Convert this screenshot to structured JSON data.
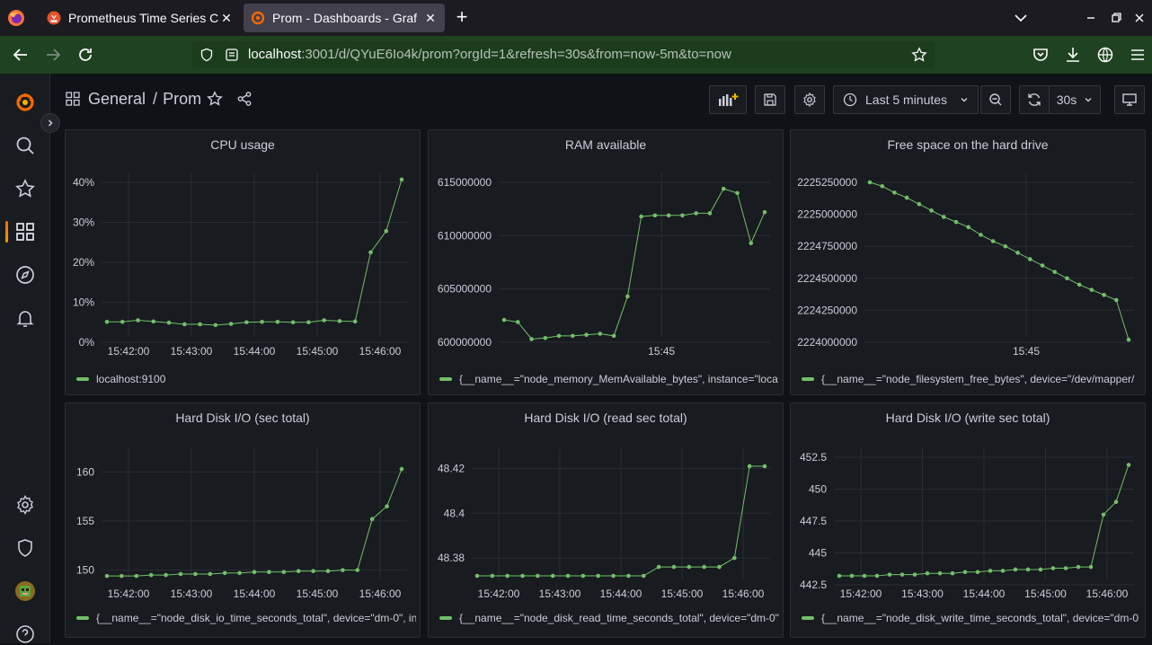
{
  "browser": {
    "tabs": [
      {
        "title": "Prometheus Time Series C",
        "active": false
      },
      {
        "title": "Prom - Dashboards - Graf",
        "active": true
      }
    ],
    "url_host": "localhost",
    "url_path": ":3001/d/QYuE6Io4k/prom?orgId=1&refresh=30s&from=now-5m&to=now"
  },
  "breadcrumb": {
    "folder": "General",
    "separator": "/",
    "dashboard": "Prom"
  },
  "toolbar": {
    "time_range": "Last 5 minutes",
    "refresh_interval": "30s"
  },
  "colors": {
    "series": "#73bf69",
    "background": "#111217",
    "panel": "#181b1f"
  },
  "panels": [
    {
      "title": "CPU usage",
      "legend": "localhost:9100",
      "chart_data": {
        "type": "line",
        "x": [
          "15:41:35",
          "15:41:50",
          "15:42:05",
          "15:42:20",
          "15:42:35",
          "15:42:50",
          "15:43:05",
          "15:43:20",
          "15:43:35",
          "15:43:50",
          "15:44:05",
          "15:44:20",
          "15:44:35",
          "15:44:50",
          "15:45:05",
          "15:45:20",
          "15:45:35",
          "15:45:50",
          "15:46:05",
          "15:46:20",
          "15:46:35"
        ],
        "values": [
          5.1,
          5.1,
          5.5,
          5.2,
          4.9,
          4.5,
          4.5,
          4.3,
          4.6,
          5.0,
          5.1,
          5.1,
          5.0,
          5.0,
          5.5,
          5.3,
          5.2,
          22.5,
          27.8,
          40.7
        ],
        "yticks": [
          "0%",
          "10%",
          "20%",
          "30%",
          "40%"
        ],
        "xticks": [
          "15:42:00",
          "15:43:00",
          "15:44:00",
          "15:45:00",
          "15:46:00"
        ],
        "ylim": [
          0,
          40
        ]
      }
    },
    {
      "title": "RAM available",
      "legend": "{__name__=\"node_memory_MemAvailable_bytes\", instance=\"loca",
      "chart_data": {
        "type": "line",
        "values": [
          602100000,
          601900000,
          600300000,
          600400000,
          600600000,
          600600000,
          600700000,
          600800000,
          600600000,
          604300000,
          611800000,
          611900000,
          611900000,
          611900000,
          612100000,
          612100000,
          614400000,
          614000000,
          609300000,
          612200000
        ],
        "yticks": [
          "600000000",
          "605000000",
          "610000000",
          "615000000"
        ],
        "xticks": [
          "15:45"
        ],
        "ylim": [
          600000000,
          615000000
        ]
      }
    },
    {
      "title": "Free space on the hard drive",
      "legend": "{__name__=\"node_filesystem_free_bytes\", device=\"/dev/mapper/",
      "chart_data": {
        "type": "line",
        "values": [
          2225250000,
          2225220000,
          2225170000,
          2225130000,
          2225080000,
          2225030000,
          2224980000,
          2224940000,
          2224900000,
          2224840000,
          2224790000,
          2224750000,
          2224700000,
          2224650000,
          2224600000,
          2224550000,
          2224500000,
          2224450000,
          2224410000,
          2224370000,
          2224330000,
          2224020000
        ],
        "yticks": [
          "2224000000",
          "2224250000",
          "2224500000",
          "2224750000",
          "2225000000",
          "2225250000"
        ],
        "xticks": [
          "15:45"
        ],
        "ylim": [
          2224000000,
          2225250000
        ]
      }
    },
    {
      "title": "Hard Disk I/O (sec total)",
      "legend": "{__name__=\"node_disk_io_time_seconds_total\", device=\"dm-0\", in",
      "chart_data": {
        "type": "line",
        "values": [
          149.4,
          149.4,
          149.4,
          149.5,
          149.5,
          149.6,
          149.6,
          149.6,
          149.7,
          149.7,
          149.8,
          149.8,
          149.8,
          149.9,
          149.9,
          149.9,
          150.0,
          150.0,
          155.2,
          156.5,
          160.3
        ],
        "yticks": [
          "150",
          "155",
          "160"
        ],
        "xticks": [
          "15:42:00",
          "15:43:00",
          "15:44:00",
          "15:45:00",
          "15:46:00"
        ],
        "ylim": [
          148.5,
          161.5
        ]
      }
    },
    {
      "title": "Hard Disk I/O (read sec total)",
      "legend": "{__name__=\"node_disk_read_time_seconds_total\", device=\"dm-0\",",
      "chart_data": {
        "type": "line",
        "values": [
          48.372,
          48.372,
          48.372,
          48.372,
          48.372,
          48.372,
          48.372,
          48.372,
          48.372,
          48.372,
          48.372,
          48.372,
          48.376,
          48.376,
          48.376,
          48.376,
          48.376,
          48.38,
          48.421,
          48.421
        ],
        "yticks": [
          "48.38",
          "48.4",
          "48.42"
        ],
        "xticks": [
          "15:42:00",
          "15:43:00",
          "15:44:00",
          "15:45:00",
          "15:46:00"
        ],
        "ylim": [
          48.368,
          48.425
        ]
      }
    },
    {
      "title": "Hard Disk I/O (write sec total)",
      "legend": "{__name__=\"node_disk_write_time_seconds_total\", device=\"dm-0",
      "chart_data": {
        "type": "line",
        "values": [
          443.2,
          443.2,
          443.2,
          443.2,
          443.3,
          443.3,
          443.3,
          443.4,
          443.4,
          443.4,
          443.5,
          443.5,
          443.6,
          443.6,
          443.7,
          443.7,
          443.7,
          443.8,
          443.8,
          443.9,
          443.9,
          448.0,
          449.0,
          451.9
        ],
        "yticks": [
          "442.5",
          "445",
          "447.5",
          "450",
          "452.5"
        ],
        "xticks": [
          "15:42:00",
          "15:43:00",
          "15:44:00",
          "15:45:00",
          "15:46:00"
        ],
        "ylim": [
          442.5,
          452.5
        ]
      }
    }
  ]
}
